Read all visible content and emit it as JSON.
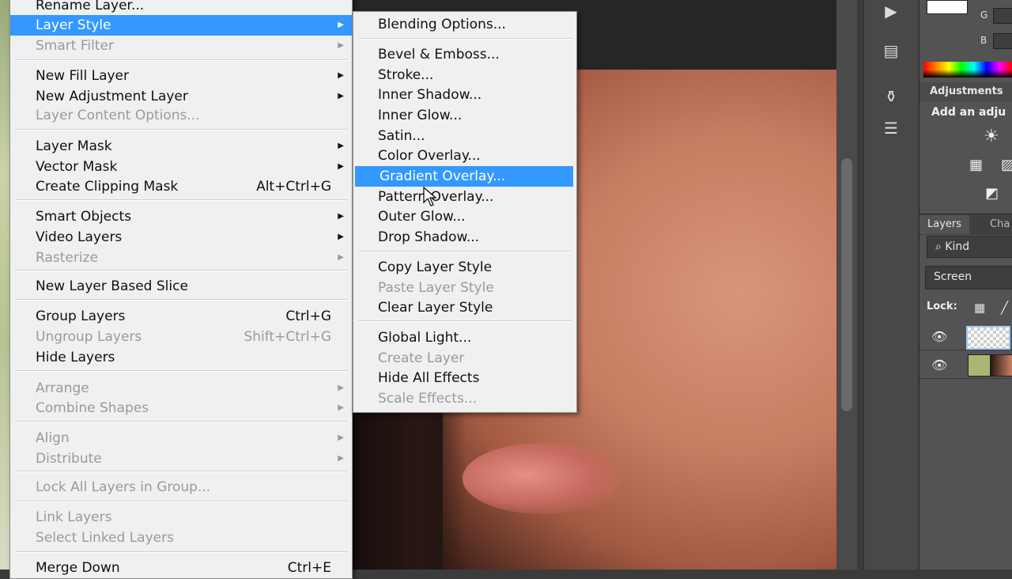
{
  "main_menu": {
    "items": [
      {
        "label": "Rename Layer...",
        "shortcut": "",
        "submenu": false,
        "disabled": false
      },
      {
        "label": "Layer Style",
        "shortcut": "",
        "submenu": true,
        "disabled": false,
        "highlighted": true
      },
      {
        "label": "Smart Filter",
        "shortcut": "",
        "submenu": true,
        "disabled": true
      },
      {
        "label": "New Fill Layer",
        "shortcut": "",
        "submenu": true,
        "disabled": false
      },
      {
        "label": "New Adjustment Layer",
        "shortcut": "",
        "submenu": true,
        "disabled": false
      },
      {
        "label": "Layer Content Options...",
        "shortcut": "",
        "submenu": false,
        "disabled": true
      },
      {
        "label": "Layer Mask",
        "shortcut": "",
        "submenu": true,
        "disabled": false
      },
      {
        "label": "Vector Mask",
        "shortcut": "",
        "submenu": true,
        "disabled": false
      },
      {
        "label": "Create Clipping Mask",
        "shortcut": "Alt+Ctrl+G",
        "submenu": false,
        "disabled": false
      },
      {
        "label": "Smart Objects",
        "shortcut": "",
        "submenu": true,
        "disabled": false
      },
      {
        "label": "Video Layers",
        "shortcut": "",
        "submenu": true,
        "disabled": false
      },
      {
        "label": "Rasterize",
        "shortcut": "",
        "submenu": true,
        "disabled": true
      },
      {
        "label": "New Layer Based Slice",
        "shortcut": "",
        "submenu": false,
        "disabled": false
      },
      {
        "label": "Group Layers",
        "shortcut": "Ctrl+G",
        "submenu": false,
        "disabled": false
      },
      {
        "label": "Ungroup Layers",
        "shortcut": "Shift+Ctrl+G",
        "submenu": false,
        "disabled": true
      },
      {
        "label": "Hide Layers",
        "shortcut": "",
        "submenu": false,
        "disabled": false
      },
      {
        "label": "Arrange",
        "shortcut": "",
        "submenu": true,
        "disabled": true
      },
      {
        "label": "Combine Shapes",
        "shortcut": "",
        "submenu": true,
        "disabled": true
      },
      {
        "label": "Align",
        "shortcut": "",
        "submenu": true,
        "disabled": true
      },
      {
        "label": "Distribute",
        "shortcut": "",
        "submenu": true,
        "disabled": true
      },
      {
        "label": "Lock All Layers in Group...",
        "shortcut": "",
        "submenu": false,
        "disabled": true
      },
      {
        "label": "Link Layers",
        "shortcut": "",
        "submenu": false,
        "disabled": true
      },
      {
        "label": "Select Linked Layers",
        "shortcut": "",
        "submenu": false,
        "disabled": true
      },
      {
        "label": "Merge Down",
        "shortcut": "Ctrl+E",
        "submenu": false,
        "disabled": false
      }
    ]
  },
  "layer_style_menu": {
    "items": [
      {
        "label": "Blending Options...",
        "disabled": false
      },
      {
        "label": "Bevel & Emboss...",
        "disabled": false
      },
      {
        "label": "Stroke...",
        "disabled": false
      },
      {
        "label": "Inner Shadow...",
        "disabled": false
      },
      {
        "label": "Inner Glow...",
        "disabled": false
      },
      {
        "label": "Satin...",
        "disabled": false
      },
      {
        "label": "Color Overlay...",
        "disabled": false
      },
      {
        "label": "Gradient Overlay...",
        "disabled": false,
        "highlighted": true
      },
      {
        "label": "Pattern Overlay...",
        "disabled": false
      },
      {
        "label": "Outer Glow...",
        "disabled": false
      },
      {
        "label": "Drop Shadow...",
        "disabled": false
      },
      {
        "label": "Copy Layer Style",
        "disabled": false
      },
      {
        "label": "Paste Layer Style",
        "disabled": true
      },
      {
        "label": "Clear Layer Style",
        "disabled": false
      },
      {
        "label": "Global Light...",
        "disabled": false
      },
      {
        "label": "Create Layer",
        "disabled": true
      },
      {
        "label": "Hide All Effects",
        "disabled": false
      },
      {
        "label": "Scale Effects...",
        "disabled": true
      }
    ]
  },
  "right_panel": {
    "color": {
      "g_label": "G",
      "b_label": "B"
    },
    "adjustments": {
      "tab": "Adjustments",
      "hint": "Add an adju"
    },
    "layers": {
      "tab_layers": "Layers",
      "tab_channels": "Cha",
      "filter_kind": "Kind",
      "blend_mode": "Screen",
      "lock_label": "Lock:"
    }
  },
  "icons": {
    "submenu_arrow": "▶",
    "eye": "👁",
    "search": "⌕"
  },
  "colors": {
    "menu_bg": "#f0f0f0",
    "highlight": "#3399ff",
    "disabled_text": "#9a9a9a",
    "panel_bg": "#535353"
  }
}
